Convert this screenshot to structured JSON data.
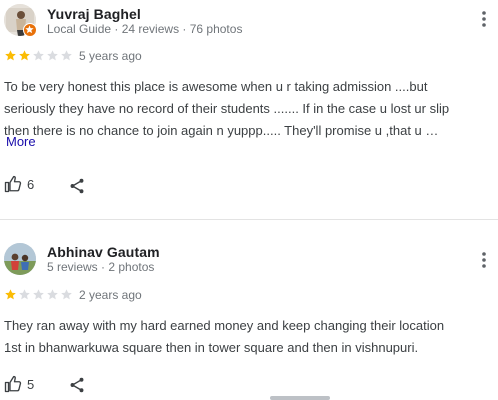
{
  "reviews": [
    {
      "author": "Yuvraj Baghel",
      "meta": "Local Guide · 24 reviews · 76 photos",
      "rating": 2,
      "age": "5 years ago",
      "text_lines": [
        "To be very honest this place is awesome when u r taking admission ....but",
        "seriously they have no record of their students ....... If in the case u lost ur slip",
        "then there is no chance to join again n yuppp..... They'll promise u ,that u …"
      ],
      "more_label": "More",
      "likes": "6"
    },
    {
      "author": "Abhinav Gautam",
      "meta": "5 reviews · 2 photos",
      "rating": 1,
      "age": "2 years ago",
      "text_lines": [
        "They ran away with my hard earned money and keep changing their location",
        "1st in bhanwarkuwa square then in tower square and then in vishnupuri."
      ],
      "likes": "5"
    }
  ],
  "colors": {
    "star_filled": "#fbbc04",
    "star_empty": "#dadce0",
    "link": "#1a0dab",
    "local_guide_badge": "#e8710a"
  },
  "icons": [
    "local-guide-badge-icon",
    "more-vert-icon",
    "star-icon",
    "thumbs-up-icon",
    "share-icon"
  ]
}
